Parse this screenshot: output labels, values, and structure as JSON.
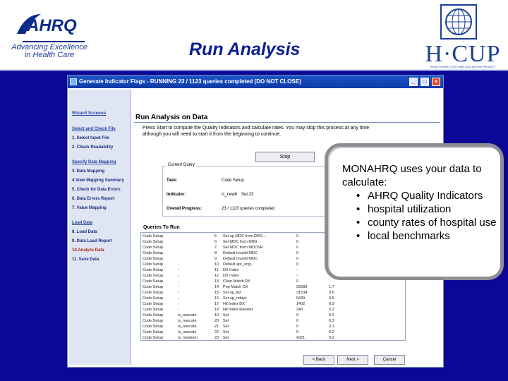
{
  "header": {
    "ahrq_logo_text": "AHRQ",
    "ahrq_tagline": "Advancing Excellence in Health Care",
    "title": "Run Analysis",
    "hcup_logo_text": "H·CUP",
    "hcup_subtitle": "HEALTHCARE COST AND UTILIZATION PROJECT",
    "colors": {
      "title": "#0a1f8f",
      "body": "#0b0896"
    }
  },
  "window": {
    "title": "Generate Indicator Flags - RUNNING 23 / 1123 queries completed (DO NOT CLOSE)",
    "min_label": "_",
    "max_label": "□",
    "close_label": "×",
    "wizard": {
      "title": "Wizard Screens",
      "sections": [
        {
          "header": "Select and Check File",
          "items": [
            "1. Select Input File",
            "2. Check Readability"
          ]
        },
        {
          "header": "Specify Data Mapping",
          "items": [
            "3. Data Mapping",
            "4.View Mapping Summary",
            "5. Check for Data Errors",
            "6. Data Errors Report",
            "7. Value Mapping"
          ]
        },
        {
          "header": "Load Data",
          "items": [
            "8. Load Data",
            "9. Data Load Report",
            "10.Analyze Data",
            "11. Save Data"
          ]
        }
      ],
      "current_item": "10.Analyze Data"
    },
    "content": {
      "title": "Run Analysis on Data",
      "description": "Press Start to compute the Quality Indicators and calculate rates. You may stop this process at any time although you will need to start it from the beginning to continue.",
      "stop_label": "Stop",
      "group_title": "Current Query",
      "task_label": "Task:",
      "task_value": "Code Setup",
      "indicator_label": "Indicator:",
      "indicator_value": "is_newb",
      "indicator_extra": "Set 23",
      "progress_label": "Overall Progress:",
      "progress_value": "23 / 1123 queries completed"
    },
    "queries": {
      "title": "Queries To Run",
      "rows": [
        [
          "Code Setup",
          "",
          "5",
          "Set up MDC from DRG...",
          "0",
          ""
        ],
        [
          "Code Setup",
          "",
          "6",
          "Set MDC from DRG",
          "0",
          ""
        ],
        [
          "Code Setup",
          "",
          "7",
          "Set MDC from MDCNR",
          "0",
          ""
        ],
        [
          "Code Setup",
          "",
          "8",
          "Default Invalid MDC",
          "0",
          ""
        ],
        [
          "Code Setup",
          "",
          "9",
          "Default Invalid MDC",
          "0",
          ""
        ],
        [
          "Code Setup",
          "-",
          "10",
          "Default apr_orig...",
          "0",
          ""
        ],
        [
          "Code Setup",
          "-",
          "11",
          "DX Index",
          "-",
          ""
        ],
        [
          "Code Setup",
          "-",
          "12",
          "DX Index",
          "-",
          ""
        ],
        [
          "Code Setup",
          "-",
          "13",
          "Clear Match DX",
          "0",
          ""
        ],
        [
          "Code Setup",
          "-",
          "14",
          "Pop Match DX",
          "92588",
          "1.7"
        ],
        [
          "Code Setup",
          "-",
          "15",
          "Set up_list",
          "31534",
          "0.6"
        ],
        [
          "Code Setup",
          "-",
          "16",
          "Set up_ndays",
          "5439",
          "0.5"
        ],
        [
          "Code Setup",
          "-",
          "17",
          "Hit Index DX",
          "1402",
          "0.3"
        ],
        [
          "Code Setup",
          "-",
          "18",
          "Hit Index Ranked",
          "340",
          "0.2"
        ],
        [
          "Code Setup",
          "is_noncate",
          "19",
          "Set",
          "0",
          "0.2"
        ],
        [
          "Code Setup",
          "is_noncate",
          "20",
          "Set",
          "0",
          "0.3"
        ],
        [
          "Code Setup",
          "is_noncate",
          "21",
          "Set",
          "0",
          "0.1"
        ],
        [
          "Code Setup",
          "is_noncate",
          "22",
          "Set",
          "0",
          "0.2"
        ],
        [
          "Code Setup",
          "is_newborn",
          "23",
          "Set",
          "4321",
          "0.2"
        ]
      ]
    },
    "buttons": {
      "back": "< Back",
      "next": "Next >",
      "cancel": "Cancel"
    }
  },
  "callout": {
    "intro": "MONAHRQ uses your data to calculate:",
    "items": [
      "AHRQ Quality Indicators",
      "hospital utilization",
      "county rates of hospital use",
      "local benchmarks"
    ]
  }
}
